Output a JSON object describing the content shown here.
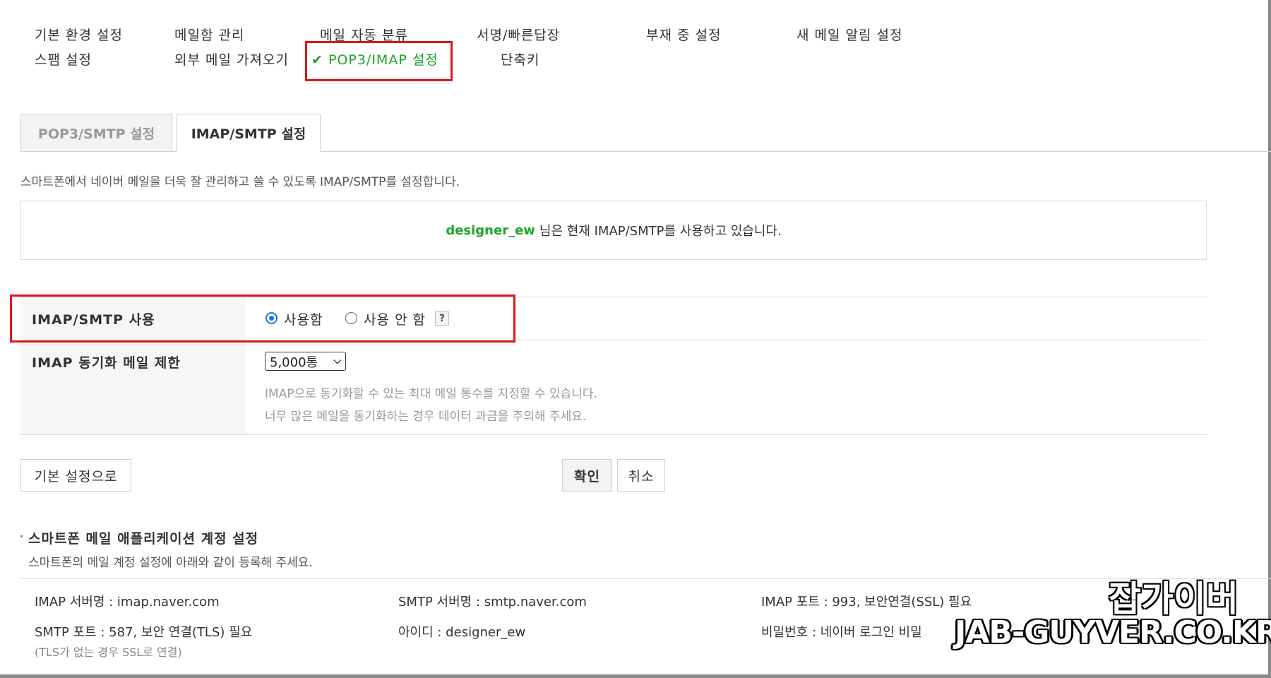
{
  "menu": {
    "row1": [
      "기본 환경 설정",
      "메일함 관리",
      "메일 자동 분류",
      "서명/빠른답장",
      "부재 중 설정",
      "새 메일 알림 설정"
    ],
    "row2": [
      "스팸 설정",
      "외부 메일 가져오기"
    ],
    "active_label": "POP3/IMAP 설정",
    "active_check": "✔",
    "shortcut_label": "단축키"
  },
  "tabs": {
    "pop3": "POP3/SMTP 설정",
    "imap": "IMAP/SMTP 설정"
  },
  "description": "스마트폰에서 네이버 메일을 더욱 잘 관리하고 쓸 수 있도록 IMAP/SMTP를 설정합니다.",
  "status": {
    "username": "designer_ew",
    "message": "님은 현재 IMAP/SMTP를 사용하고 있습니다."
  },
  "settings": {
    "imap_use": {
      "label": "IMAP/SMTP 사용",
      "option_on": "사용함",
      "option_off": "사용 안 함",
      "selected": "사용함",
      "help": "?"
    },
    "sync_limit": {
      "label": "IMAP 동기화 메일 제한",
      "value": "5,000통",
      "hint1": "IMAP으로 동기화할 수 있는 최대 메일 통수를 지정할 수 있습니다.",
      "hint2": "너무 많은 메일을 동기화하는 경우 데이터 과금을 주의해 주세요."
    }
  },
  "buttons": {
    "reset": "기본 설정으로",
    "confirm": "확인",
    "cancel": "취소"
  },
  "smartphone": {
    "title": "스마트폰 메일 애플리케이션 계정 설정",
    "subtitle": "스마트폰의 메일 계정 설정에 아래와 같이 등록해 주세요.",
    "imap_server": "IMAP 서버명 : imap.naver.com",
    "smtp_server": "SMTP 서버명 : smtp.naver.com",
    "imap_port": "IMAP 포트 : 993, 보안연결(SSL) 필요",
    "smtp_port": "SMTP 포트 : 587, 보안 연결(TLS) 필요",
    "smtp_port_note": "(TLS가 없는 경우 SSL로 연결)",
    "id": "아이디 : designer_ew",
    "password": "비밀번호 : 네이버 로그인 비밀"
  },
  "watermark": {
    "line1": "잡가이버",
    "line2": "JAB-GUYVER.CO.KR"
  },
  "colors": {
    "accent_green": "#1ea328",
    "highlight_red": "#e0141e",
    "radio_blue": "#1a73e8"
  }
}
